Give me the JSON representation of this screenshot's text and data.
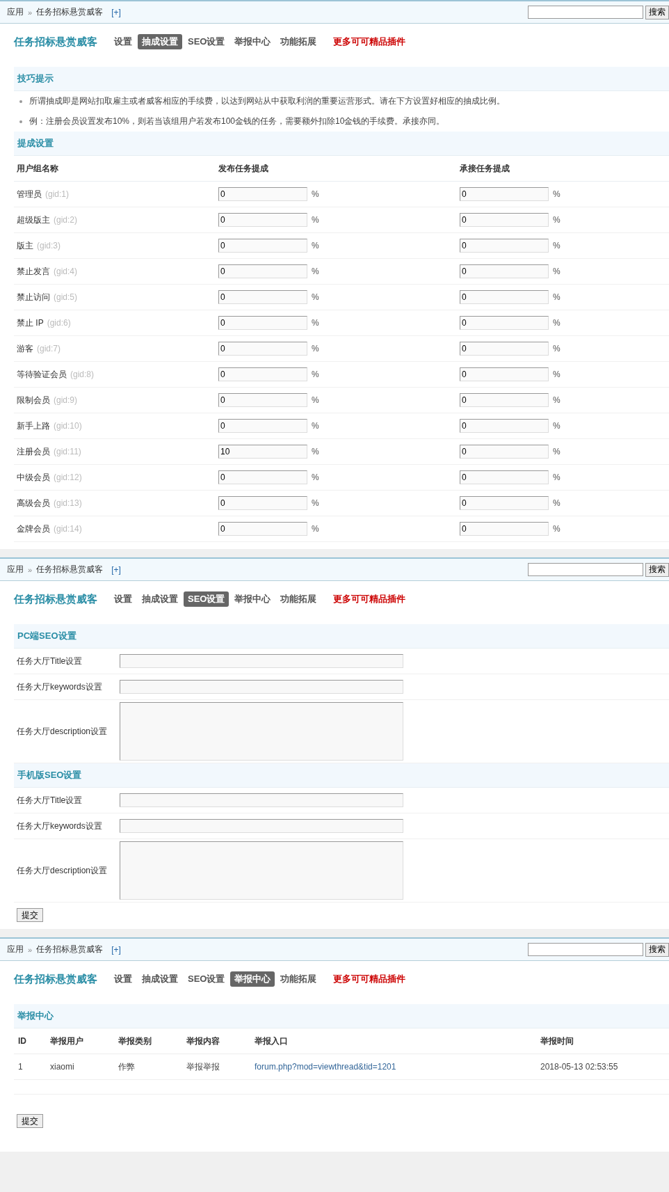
{
  "panels": [
    {
      "breadcrumb": {
        "root": "应用",
        "separator": "»",
        "current": "任务招标悬赏威客",
        "add": "[+]"
      },
      "search_button": "搜索",
      "plugin_title": "任务招标悬赏威客",
      "tabs": [
        {
          "label": "设置",
          "selected": false
        },
        {
          "label": "抽成设置",
          "selected": true
        },
        {
          "label": "SEO设置",
          "selected": false
        },
        {
          "label": "举报中心",
          "selected": false
        },
        {
          "label": "功能拓展",
          "selected": false
        }
      ],
      "more_link": "更多可可精品插件",
      "sections": [
        {
          "kind": "tips",
          "title": "技巧提示",
          "items": [
            "所谓抽成即是网站扣取雇主或者威客相应的手续费，以达到网站从中获取利润的重要运营形式。请在下方设置好相应的抽成比例。",
            "例：注册会员设置发布10%，则若当该组用户若发布100金钱的任务，需要额外扣除10金钱的手续费。承接亦同。"
          ]
        },
        {
          "kind": "commission",
          "title": "提成设置",
          "columns": [
            "用户组名称",
            "发布任务提成",
            "承接任务提成"
          ],
          "unit": "%",
          "rows": [
            {
              "group": "管理员",
              "gid": "(gid:1)",
              "publish": "0",
              "accept": "0"
            },
            {
              "group": "超级版主",
              "gid": "(gid:2)",
              "publish": "0",
              "accept": "0"
            },
            {
              "group": "版主",
              "gid": "(gid:3)",
              "publish": "0",
              "accept": "0"
            },
            {
              "group": "禁止发言",
              "gid": "(gid:4)",
              "publish": "0",
              "accept": "0"
            },
            {
              "group": "禁止访问",
              "gid": "(gid:5)",
              "publish": "0",
              "accept": "0"
            },
            {
              "group": "禁止 IP",
              "gid": "(gid:6)",
              "publish": "0",
              "accept": "0"
            },
            {
              "group": "游客",
              "gid": "(gid:7)",
              "publish": "0",
              "accept": "0"
            },
            {
              "group": "等待验证会员",
              "gid": "(gid:8)",
              "publish": "0",
              "accept": "0"
            },
            {
              "group": "限制会员",
              "gid": "(gid:9)",
              "publish": "0",
              "accept": "0"
            },
            {
              "group": "新手上路",
              "gid": "(gid:10)",
              "publish": "0",
              "accept": "0"
            },
            {
              "group": "注册会员",
              "gid": "(gid:11)",
              "publish": "10",
              "accept": "0"
            },
            {
              "group": "中级会员",
              "gid": "(gid:12)",
              "publish": "0",
              "accept": "0"
            },
            {
              "group": "高级会员",
              "gid": "(gid:13)",
              "publish": "0",
              "accept": "0"
            },
            {
              "group": "金牌会员",
              "gid": "(gid:14)",
              "publish": "0",
              "accept": "0"
            }
          ]
        }
      ]
    },
    {
      "breadcrumb": {
        "root": "应用",
        "separator": "»",
        "current": "任务招标悬赏威客",
        "add": "[+]"
      },
      "search_button": "搜索",
      "plugin_title": "任务招标悬赏威客",
      "tabs": [
        {
          "label": "设置",
          "selected": false
        },
        {
          "label": "抽成设置",
          "selected": false
        },
        {
          "label": "SEO设置",
          "selected": true
        },
        {
          "label": "举报中心",
          "selected": false
        },
        {
          "label": "功能拓展",
          "selected": false
        }
      ],
      "more_link": "更多可可精品插件",
      "sections": [
        {
          "kind": "form",
          "title": "PC端SEO设置",
          "fields": [
            {
              "label": "任务大厅Title设置",
              "kind": "text"
            },
            {
              "label": "任务大厅keywords设置",
              "kind": "text"
            },
            {
              "label": "任务大厅description设置",
              "kind": "textarea"
            }
          ]
        },
        {
          "kind": "form",
          "title": "手机版SEO设置",
          "fields": [
            {
              "label": "任务大厅Title设置",
              "kind": "text"
            },
            {
              "label": "任务大厅keywords设置",
              "kind": "text"
            },
            {
              "label": "任务大厅description设置",
              "kind": "textarea"
            }
          ]
        }
      ],
      "submit": "提交"
    },
    {
      "breadcrumb": {
        "root": "应用",
        "separator": "»",
        "current": "任务招标悬赏威客",
        "add": "[+]"
      },
      "search_button": "搜索",
      "plugin_title": "任务招标悬赏威客",
      "tabs": [
        {
          "label": "设置",
          "selected": false
        },
        {
          "label": "抽成设置",
          "selected": false
        },
        {
          "label": "SEO设置",
          "selected": false
        },
        {
          "label": "举报中心",
          "selected": true
        },
        {
          "label": "功能拓展",
          "selected": false
        }
      ],
      "more_link": "更多可可精品插件",
      "sections": [
        {
          "kind": "reports",
          "title": "举报中心",
          "columns": [
            "ID",
            "举报用户",
            "举报类别",
            "举报内容",
            "举报入口",
            "举报时间"
          ],
          "rows": [
            {
              "cells": [
                {
                  "text": "1",
                  "kind": "text"
                },
                {
                  "text": "xiaomi",
                  "kind": "text"
                },
                {
                  "text": "作弊",
                  "kind": "text"
                },
                {
                  "text": "举报举报",
                  "kind": "text"
                },
                {
                  "text": "forum.php?mod=viewthread&tid=1201",
                  "kind": "link"
                },
                {
                  "text": "2018-05-13 02:53:55",
                  "kind": "text"
                }
              ]
            }
          ]
        }
      ],
      "submit": "提交"
    }
  ]
}
